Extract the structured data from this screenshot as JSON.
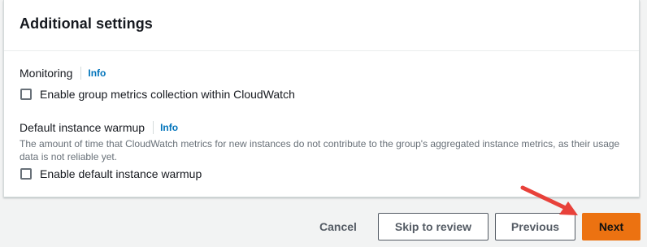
{
  "panel": {
    "title": "Additional settings",
    "monitoring": {
      "label": "Monitoring",
      "info": "Info",
      "checkbox_label": "Enable group metrics collection within CloudWatch",
      "checked": false
    },
    "warmup": {
      "label": "Default instance warmup",
      "info": "Info",
      "description": "The amount of time that CloudWatch metrics for new instances do not contribute to the group's aggregated instance metrics, as their usage data is not reliable yet.",
      "checkbox_label": "Enable default instance warmup",
      "checked": false
    }
  },
  "footer": {
    "cancel_label": "Cancel",
    "skip_label": "Skip to review",
    "previous_label": "Previous",
    "next_label": "Next"
  },
  "colors": {
    "primary": "#ec7211",
    "link": "#0073bb",
    "annotation_arrow": "#e8413a"
  },
  "icons": {
    "annotation": "red-arrow-icon"
  }
}
